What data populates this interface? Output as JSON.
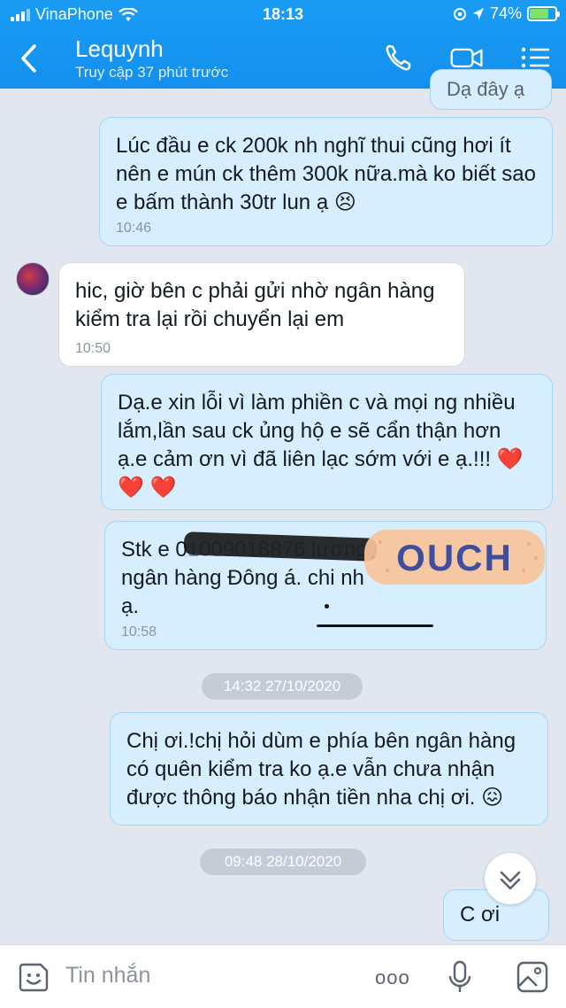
{
  "status_bar": {
    "carrier": "VinaPhone",
    "time": "18:13",
    "battery": "74%",
    "battery_level": 0.74
  },
  "header": {
    "contact_name": "Lequynh",
    "contact_status": "Truy cập 37 phút trước"
  },
  "partial_top": "Dạ đây ạ",
  "messages": [
    {
      "from": "me",
      "text": "Lúc đầu e ck 200k nh nghĩ thui cũng hơi ít nên e mún ck thêm 300k nữa.mà ko biết sao e bấm thành 30tr lun ạ 😣",
      "time": "10:46"
    },
    {
      "from": "contact",
      "text": "hic, giờ bên c phải gửi nhờ ngân hàng kiểm tra lại rồi chuyển lại em",
      "time": "10:50"
    },
    {
      "from": "me",
      "text": "Dạ.e xin lỗi vì làm phiền c và mọi ng nhiều lắm,lần sau ck ủng hộ e sẽ cẩn thận hơn ạ.e cảm ơn vì đã liên lạc sớm với e ạ.!!! ❤️ ❤️ ❤️"
    },
    {
      "from": "me",
      "line1_prefix": "Stk e 0",
      "line1_obscured": "1009018876 lương",
      "line2": "ngân hàng Đông á. chi nh",
      "line3": "ạ.",
      "time": "10:58"
    },
    {
      "from": "me",
      "text": "Chị ơi.!chị hỏi dùm e phía bên ngân hàng có quên kiểm tra ko ạ.e vẫn chưa nhận được thông báo nhận tiền nha chị ơi. 😖"
    },
    {
      "from": "me",
      "text": "C ơi"
    }
  ],
  "date_separators": [
    "14:32 27/10/2020",
    "09:48 28/10/2020"
  ],
  "sticker_text": "OUCH",
  "composer": {
    "placeholder": "Tin nhắn",
    "more": "ooo"
  },
  "colors": {
    "header": "#1390ee",
    "bubble_out": "#d7eefe",
    "bubble_in": "#ffffff",
    "background": "#e2e7ef"
  }
}
